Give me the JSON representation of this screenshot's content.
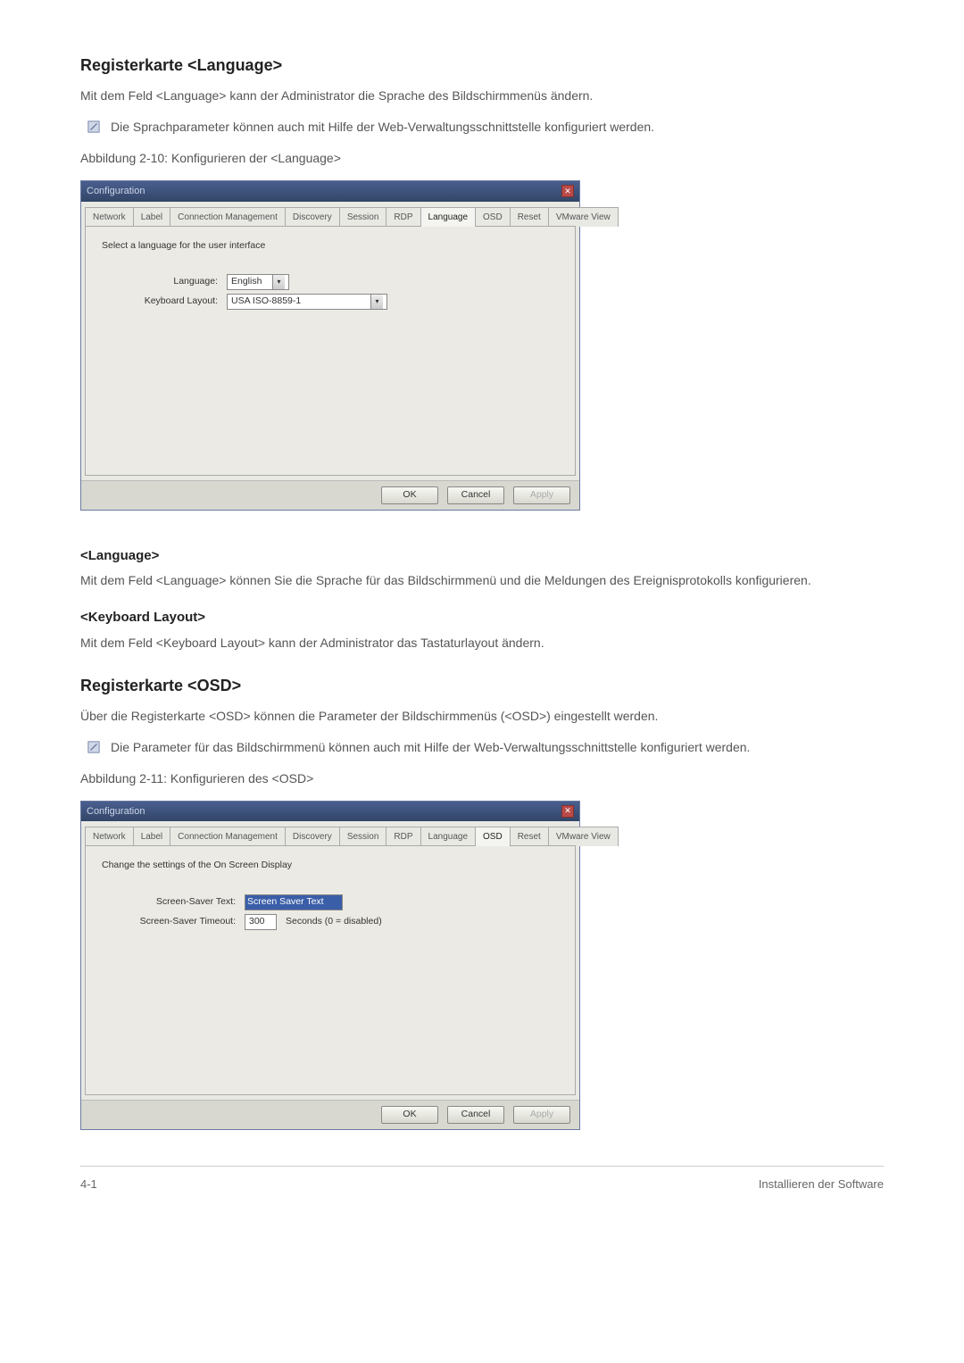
{
  "section1": {
    "title": "Registerkarte <Language>",
    "intro": "Mit dem Feld <Language> kann der Administrator die Sprache des Bildschirmmenüs ändern.",
    "note": "Die Sprachparameter können auch mit Hilfe der Web-Verwaltungsschnittstelle konfiguriert werden.",
    "caption": "Abbildung 2-10: Konfigurieren der <Language>"
  },
  "dialog_common": {
    "title": "Configuration",
    "tabs": [
      "Network",
      "Label",
      "Connection Management",
      "Discovery",
      "Session",
      "RDP",
      "Language",
      "OSD",
      "Reset",
      "VMware View"
    ],
    "ok": "OK",
    "cancel": "Cancel",
    "apply": "Apply"
  },
  "dialog1": {
    "active_tab_index": 6,
    "instruction": "Select a language for the user interface",
    "language_label": "Language:",
    "language_value": "English",
    "keyboard_label": "Keyboard Layout:",
    "keyboard_value": "USA ISO-8859-1"
  },
  "section2": {
    "sub1_title": "<Language>",
    "sub1_text": "Mit dem Feld <Language> können Sie die Sprache für das Bildschirmmenü und die Meldungen des Ereignisprotokolls konfigurieren.",
    "sub2_title": "<Keyboard Layout>",
    "sub2_text": "Mit dem Feld <Keyboard Layout> kann der Administrator das Tastaturlayout ändern."
  },
  "section3": {
    "title": "Registerkarte <OSD>",
    "intro": "Über die Registerkarte <OSD> können die Parameter der Bildschirmmenüs (<OSD>) eingestellt werden.",
    "note": "Die Parameter für das Bildschirmmenü können auch mit Hilfe der Web-Verwaltungsschnittstelle konfiguriert werden.",
    "caption": "Abbildung 2-11: Konfigurieren des <OSD>"
  },
  "dialog2": {
    "active_tab_index": 7,
    "instruction": "Change the settings of the On Screen Display",
    "ss_text_label": "Screen-Saver Text:",
    "ss_text_value": "Screen Saver Text",
    "ss_timeout_label": "Screen-Saver Timeout:",
    "ss_timeout_value": "300",
    "ss_timeout_suffix": "Seconds (0 = disabled)"
  },
  "footer": {
    "left": "4-1",
    "right": "Installieren der Software"
  }
}
